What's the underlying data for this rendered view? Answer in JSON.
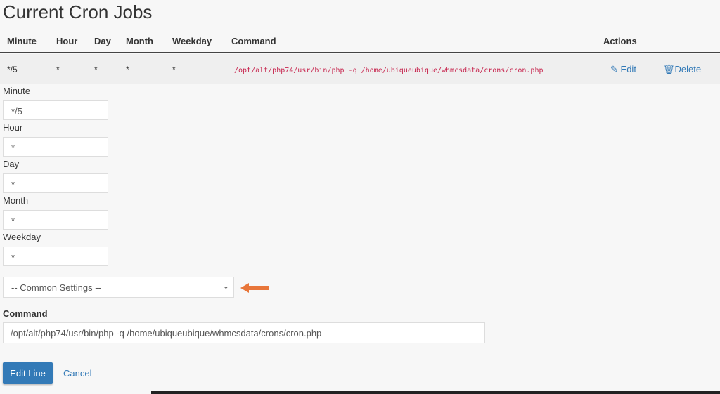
{
  "title": "Current Cron Jobs",
  "table": {
    "headers": {
      "minute": "Minute",
      "hour": "Hour",
      "day": "Day",
      "month": "Month",
      "weekday": "Weekday",
      "command": "Command",
      "actions": "Actions"
    },
    "rows": [
      {
        "minute": "*/5",
        "hour": "*",
        "day": "*",
        "month": "*",
        "weekday": "*",
        "command": "/opt/alt/php74/usr/bin/php -q /home/ubiqueubique/whmcsdata/crons/cron.php",
        "edit": "Edit",
        "delete": "Delete"
      }
    ]
  },
  "form": {
    "minute_label": "Minute",
    "minute": "*/5",
    "hour_label": "Hour",
    "hour": "*",
    "day_label": "Day",
    "day": "*",
    "month_label": "Month",
    "month": "*",
    "weekday_label": "Weekday",
    "weekday": "*",
    "common_settings": "-- Common Settings --",
    "command_label": "Command",
    "command": "/opt/alt/php74/usr/bin/php -q /home/ubiqueubique/whmcsdata/crons/cron.php",
    "submit": "Edit Line",
    "cancel": "Cancel"
  },
  "colors": {
    "accent": "#337ab7",
    "command_text": "#c7254e",
    "arrow": "#e8763a"
  }
}
